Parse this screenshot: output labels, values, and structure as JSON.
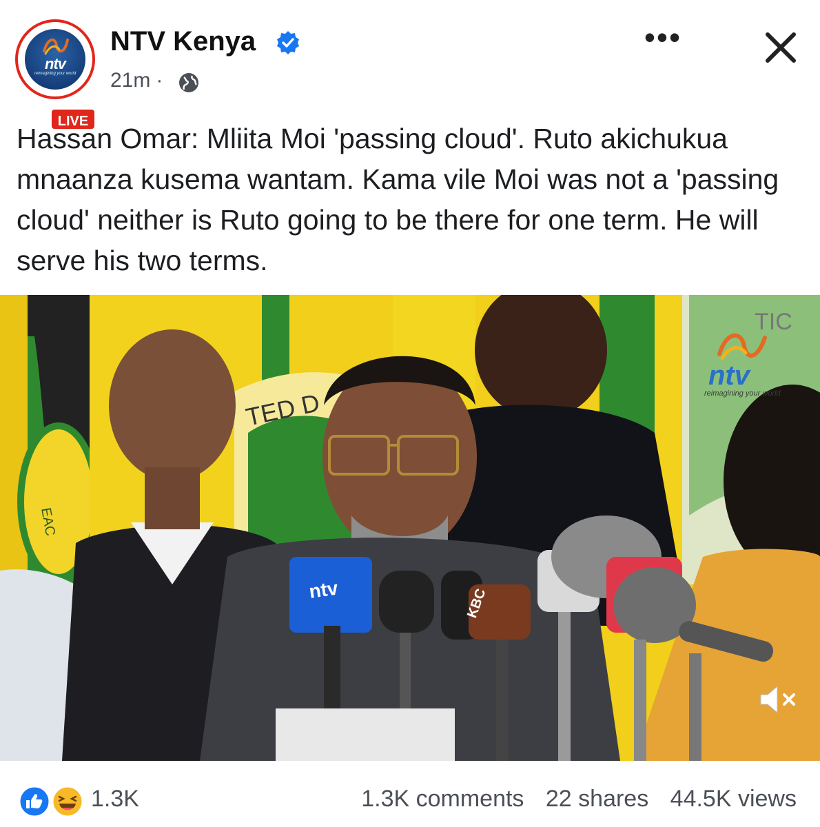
{
  "header": {
    "page_name": "NTV Kenya",
    "avatar_logo_text": "ntv",
    "avatar_tagline": "reimagining your world",
    "live_badge": "LIVE",
    "time": "21m",
    "separator": "·",
    "icons": {
      "verified": "verified-badge-icon",
      "audience": "globe-icon",
      "more": "more-options-icon",
      "close": "close-icon"
    },
    "more_label": "•••"
  },
  "post": {
    "text": "Hassan Omar: Mliita Moi 'passing cloud'. Ruto akichukua mnaanza kusema wantam. Kama vile Moi was not a 'passing cloud' neither is Ruto going to be there for one term. He will serve his two terms."
  },
  "media": {
    "watermark_logo": "ntv",
    "watermark_tagline": "reimagining your world",
    "banner_text_left": "TED D",
    "banner_text_right": "TIC",
    "mic_labels": [
      "ntv",
      "KBC"
    ],
    "mute_icon": "speaker-muted-icon"
  },
  "footer": {
    "reaction_icons": [
      "like-icon",
      "haha-icon"
    ],
    "reaction_count": "1.3K",
    "comments": "1.3K comments",
    "shares": "22 shares",
    "views": "44.5K views"
  },
  "colors": {
    "brand_blue": "#1877f2",
    "live_red": "#e1261c",
    "banner_yellow": "#f1cf1a",
    "banner_green": "#2f8a2f"
  }
}
